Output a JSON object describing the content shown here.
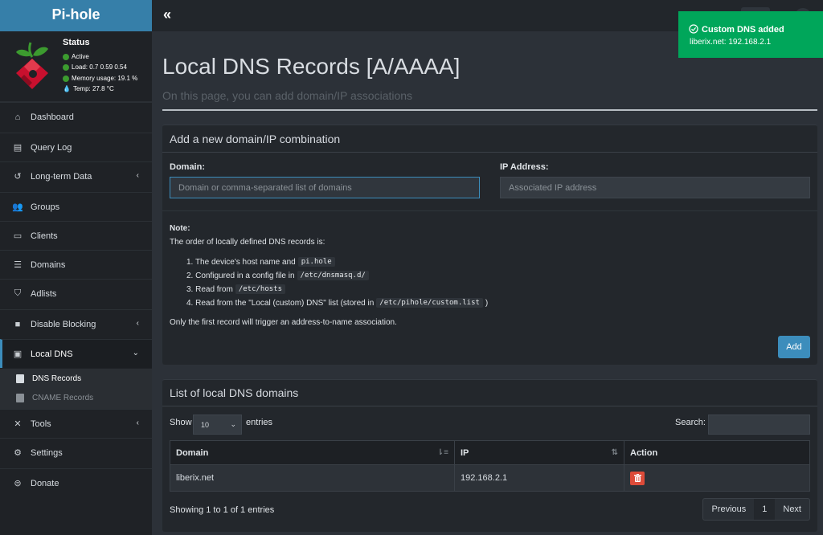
{
  "brand": "Pi-hole",
  "status": {
    "title": "Status",
    "active": "Active",
    "load": "Load:  0.7  0.59  0.54",
    "memory": "Memory usage:  19.1 %",
    "temp": "Temp: 27.8 °C"
  },
  "nav": {
    "dashboard": "Dashboard",
    "query_log": "Query Log",
    "long_term": "Long-term Data",
    "groups": "Groups",
    "clients": "Clients",
    "domains": "Domains",
    "adlists": "Adlists",
    "disable_blocking": "Disable Blocking",
    "local_dns": "Local DNS",
    "dns_records": "DNS Records",
    "cname_records": "CNAME Records",
    "tools": "Tools",
    "settings": "Settings",
    "donate": "Donate"
  },
  "page": {
    "title": "Local DNS Records [A/AAAA]",
    "subtitle": "On this page, you can add domain/IP associations"
  },
  "add_box": {
    "title": "Add a new domain/IP combination",
    "domain_label": "Domain:",
    "domain_placeholder": "Domain or comma-separated list of domains",
    "ip_label": "IP Address:",
    "ip_placeholder": "Associated IP address",
    "note_title": "Note:",
    "note_intro": "The order of locally defined DNS records is:",
    "items": {
      "i1_text": "1. The device's host name and",
      "i1_code": "pi.hole",
      "i2_text": "2. Configured in a config file in",
      "i2_code": "/etc/dnsmasq.d/",
      "i3_text": "3. Read from",
      "i3_code": "/etc/hosts",
      "i4_text": "4. Read from the \"Local (custom) DNS\" list (stored in",
      "i4_code": "/etc/pihole/custom.list",
      "i4_close": ")"
    },
    "note_footer": "Only the first record will trigger an address-to-name association.",
    "add_button": "Add"
  },
  "list_box": {
    "title": "List of local DNS domains",
    "show": "Show",
    "entries": "entries",
    "page_size": "10",
    "search_label": "Search:",
    "columns": {
      "domain": "Domain",
      "ip": "IP",
      "action": "Action"
    },
    "rows": [
      {
        "domain": "liberix.net",
        "ip": "192.168.2.1"
      }
    ],
    "showing": "Showing 1 to 1 of 1 entries",
    "pager": {
      "prev": "Previous",
      "page": "1",
      "next": "Next"
    }
  },
  "toast": {
    "title": "Custom DNS added",
    "message": "liberix.net: 192.168.2.1"
  }
}
